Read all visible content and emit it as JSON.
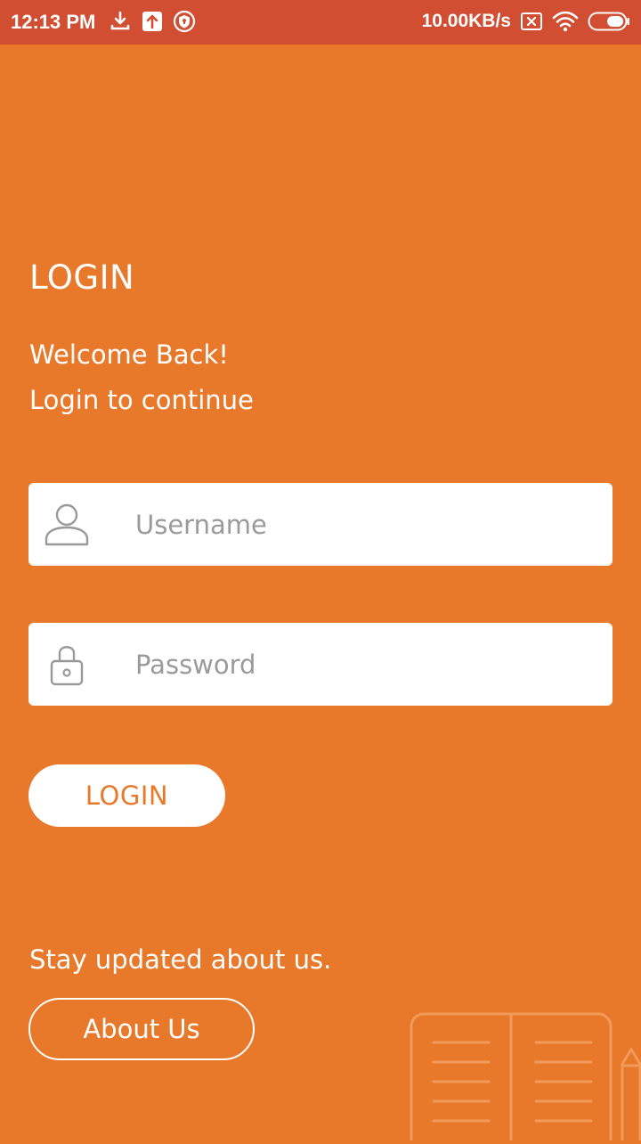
{
  "status_bar": {
    "time": "12:13 PM",
    "network_speed": "10.00KB/s"
  },
  "login": {
    "title": "LOGIN",
    "welcome": "Welcome Back!",
    "subtitle": "Login to continue"
  },
  "form": {
    "username_placeholder": "Username",
    "password_placeholder": "Password",
    "login_button": "LOGIN"
  },
  "footer": {
    "stay_text": "Stay updated about us.",
    "about_button": "About Us"
  },
  "colors": {
    "background": "#E8792B",
    "status_bar": "#D24E33",
    "field": "#FFFFFF",
    "button_text": "#E8792B"
  },
  "icons": [
    "download-icon",
    "upload-icon",
    "shield-icon",
    "sim-off-icon",
    "wifi-icon",
    "battery-icon",
    "user-icon",
    "lock-icon",
    "book-icon"
  ]
}
